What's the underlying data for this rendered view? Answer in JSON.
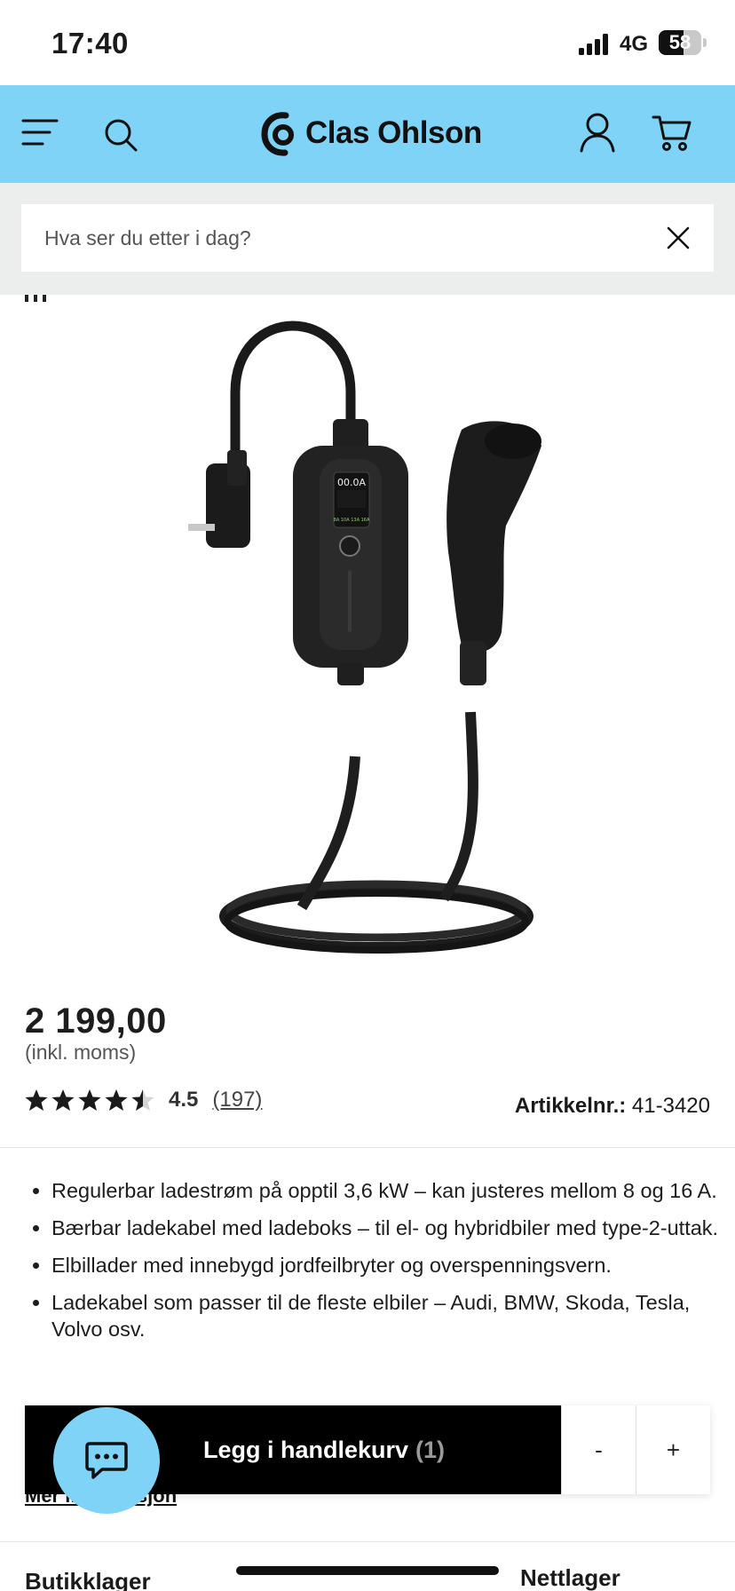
{
  "status_bar": {
    "time": "17:40",
    "network": "4G",
    "battery": "58",
    "battery_level": 0.58
  },
  "header": {
    "brand": "Clas Ohlson",
    "icons": [
      "menu-icon",
      "search-icon",
      "account-icon",
      "cart-icon"
    ]
  },
  "search": {
    "placeholder": "Hva ser du etter i dag?"
  },
  "product": {
    "price": "2 199,00",
    "vat_note": "(inkl. moms)",
    "rating": 4.5,
    "rating_label": "4.5",
    "review_count": "(197)",
    "sku_label": "Artikkelnr.:",
    "sku": "41-3420",
    "bullets": [
      "Regulerbar ladestrøm på opptil 3,6 kW – kan justeres mellom 8 og 16 A.",
      "Bærbar ladekabel med ladeboks – til el- og hybridbiler med type-2-uttak.",
      "Elbillader med innebygd jordfeilbryter og overspenningsvern.",
      "Ladekabel som passer til de fleste elbiler – Audi, BMW, Skoda, Tesla, Volvo osv."
    ],
    "more_info": "Mer informasjon",
    "device_display": {
      "current": "00.0A",
      "bottom_row": "8A 10A 13A 16A"
    }
  },
  "cart": {
    "add_label": "Legg i handlekurv",
    "quantity": "(1)",
    "minus": "-",
    "plus": "+"
  },
  "stock": {
    "store": "Butikklager",
    "online": "Nettlager"
  },
  "colors": {
    "header_bg": "#7fd3f7",
    "search_band": "#eceeed",
    "cart_button": "#000000"
  }
}
